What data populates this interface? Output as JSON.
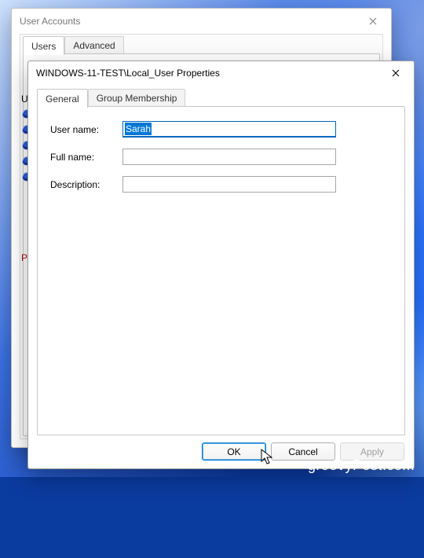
{
  "back_window": {
    "title": "User Accounts",
    "tabs": [
      {
        "label": "Users",
        "active": true
      },
      {
        "label": "Advanced",
        "active": false
      }
    ],
    "peek_label": "Us"
  },
  "front_window": {
    "title": "WINDOWS-11-TEST\\Local_User Properties",
    "tabs": [
      {
        "label": "General",
        "active": true
      },
      {
        "label": "Group Membership",
        "active": false
      }
    ],
    "form": {
      "username_label": "User name:",
      "username_value": "Sarah",
      "fullname_label": "Full name:",
      "fullname_value": "",
      "description_label": "Description:",
      "description_value": ""
    },
    "buttons": {
      "ok": "OK",
      "cancel": "Cancel",
      "apply": "Apply"
    }
  },
  "watermark": "groovyPost.com"
}
